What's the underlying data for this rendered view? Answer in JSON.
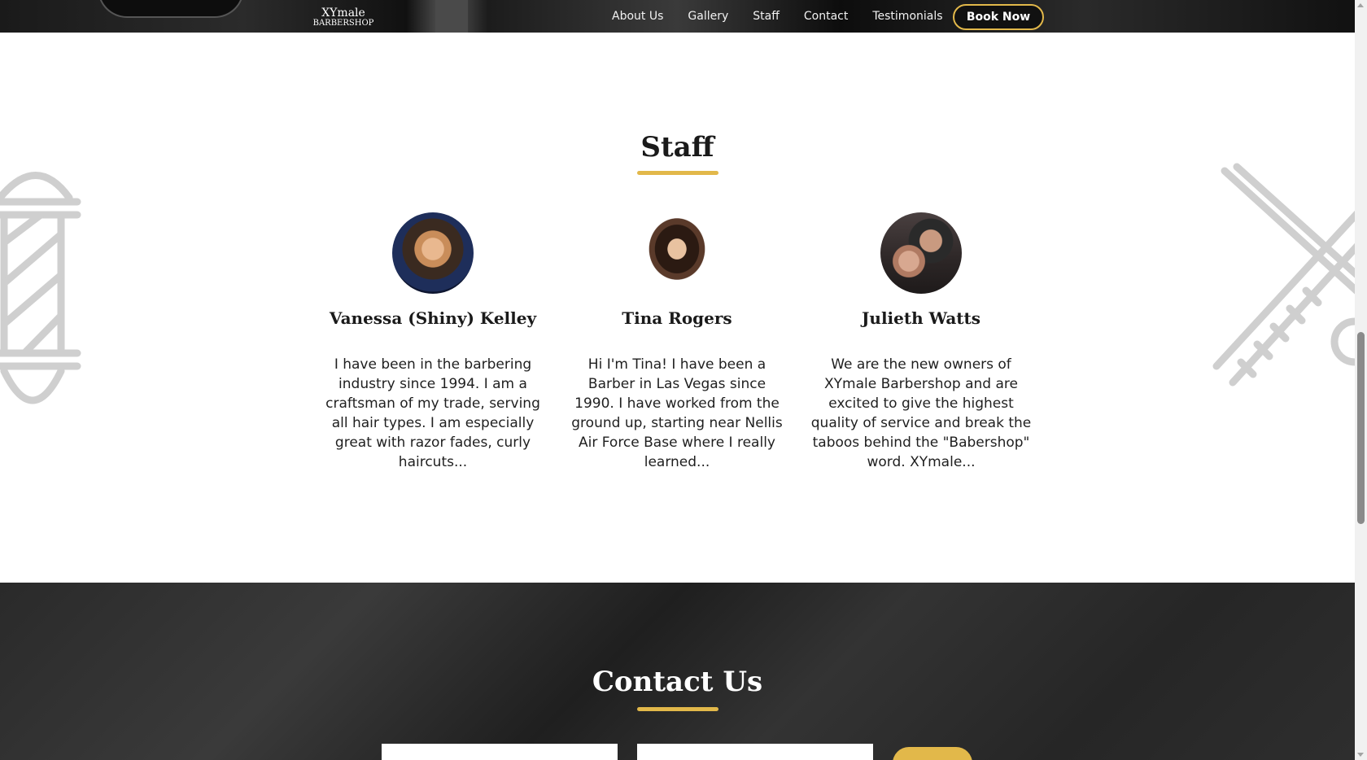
{
  "header": {
    "logo_top": "XYmale",
    "logo_bottom": "BARBERSHOP",
    "nav": [
      "About Us",
      "Gallery",
      "Staff",
      "Contact",
      "Testimonials"
    ],
    "book_button": "Book Now"
  },
  "staff": {
    "title": "Staff",
    "members": [
      {
        "name": "Vanessa (Shiny) Kelley",
        "bio": "I have been in the barbering industry since 1994. I am a craftsman of my trade, serving all hair types. I am especially great with razor fades, curly haircuts..."
      },
      {
        "name": "Tina Rogers",
        "bio": "Hi I'm Tina! I have been a Barber in Las Vegas since 1990. I have worked from the ground up, starting near Nellis Air Force Base where I really learned..."
      },
      {
        "name": "Julieth Watts",
        "bio": "We are the new owners of XYmale Barbershop and are excited to give the highest quality of service and break the taboos behind the \"Babershop\" word. XYmale..."
      }
    ]
  },
  "contact": {
    "title": "Contact Us"
  },
  "colors": {
    "accent": "#e2b84a",
    "dark": "#111111"
  }
}
